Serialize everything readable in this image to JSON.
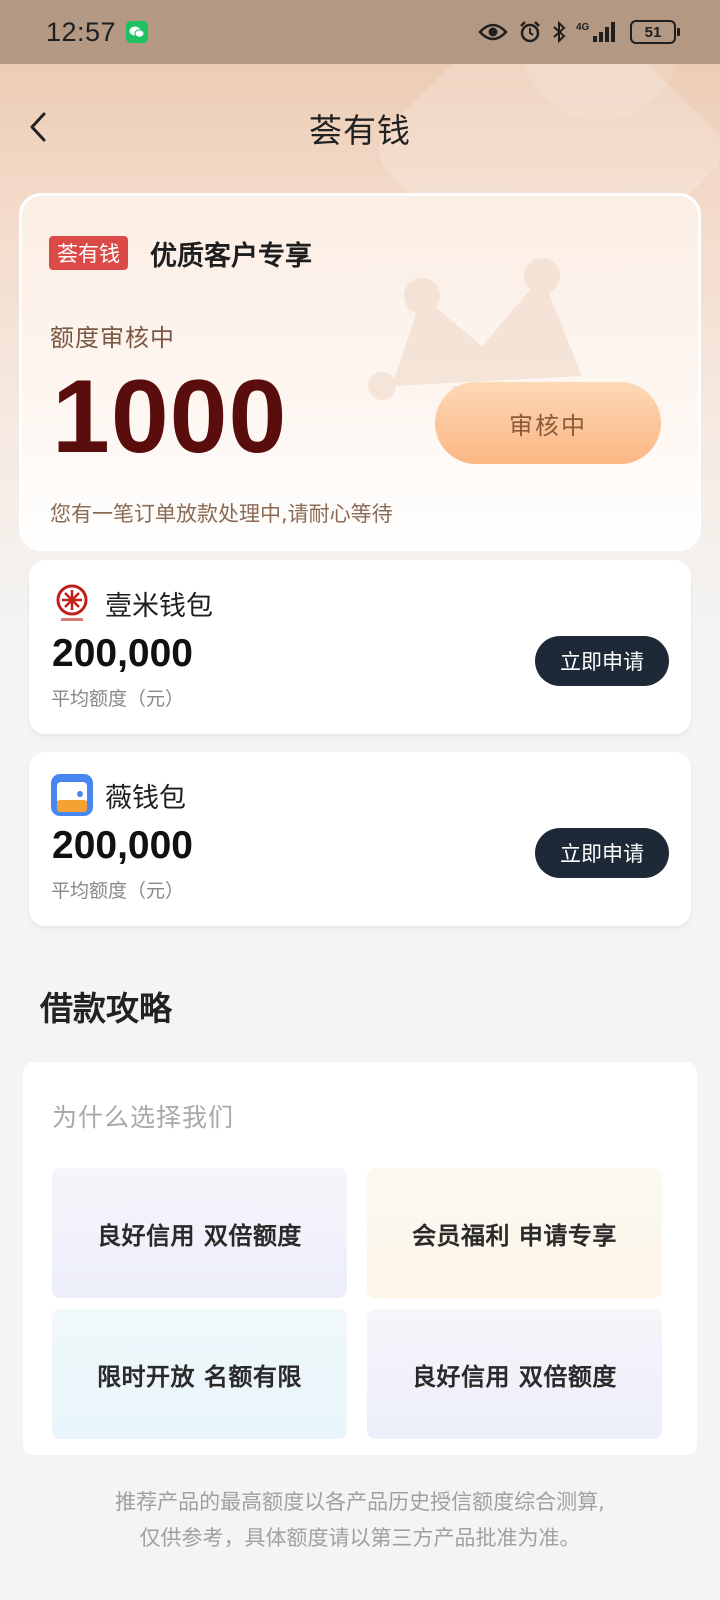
{
  "status_bar": {
    "time": "12:57",
    "network": "4G",
    "battery": "51"
  },
  "nav": {
    "title": "荟有钱"
  },
  "hero": {
    "badge": "荟有钱",
    "subtitle": "优质客户专享",
    "quota_label": "额度审核中",
    "amount": "1000",
    "button_label": "审核中",
    "note": "您有一笔订单放款处理中,请耐心等待"
  },
  "products": [
    {
      "name": "壹米钱包",
      "amount": "200,000",
      "amount_label": "平均额度（元）",
      "button_label": "立即申请",
      "logo": "yimi-logo-icon"
    },
    {
      "name": "薇钱包",
      "amount": "200,000",
      "amount_label": "平均额度（元）",
      "button_label": "立即申请",
      "logo": "weiqianbao-logo-icon"
    }
  ],
  "guide": {
    "title": "借款攻略",
    "subtitle": "为什么选择我们",
    "cards": [
      "良好信用 双倍额度",
      "会员福利 申请专享",
      "限时开放 名额有限",
      "良好信用 双倍额度"
    ]
  },
  "disclaimer": {
    "line1": "推荐产品的最高额度以各产品历史授信额度综合测算,",
    "line2": "仅供参考，具体额度请以第三方产品批准为准。"
  },
  "colors": {
    "badge_red": "#dc4a47",
    "amount_dark_red": "#5a0d0d",
    "apply_button": "#1e2937",
    "review_button": "#fbb683"
  }
}
